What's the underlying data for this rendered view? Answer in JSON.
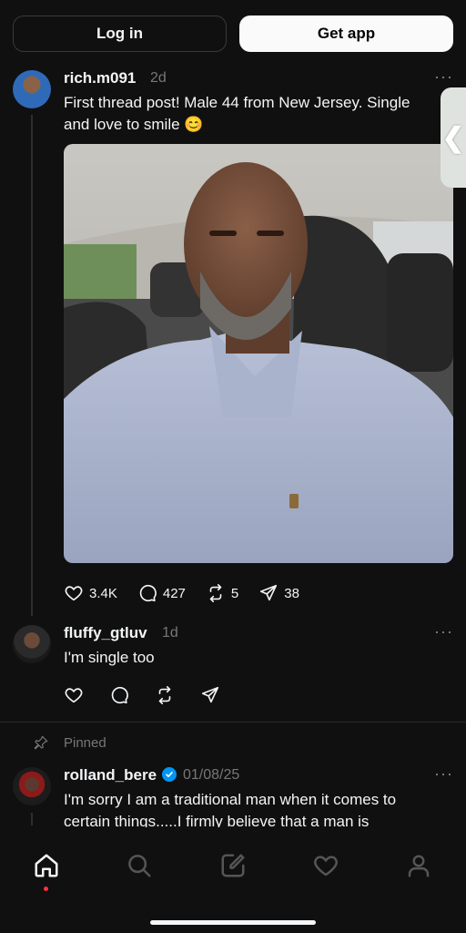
{
  "header": {
    "login_label": "Log in",
    "get_app_label": "Get app"
  },
  "posts": [
    {
      "username": "rich.m091",
      "time": "2d",
      "text_line1": "First thread post! Male 44 from New Jersey. Single",
      "text_line2": "and love to smile 😊",
      "likes": "3.4K",
      "replies": "427",
      "reposts": "5",
      "shares": "38"
    },
    {
      "username": "fluffy_gtluv",
      "time": "1d",
      "text": "I'm single too"
    },
    {
      "pinned_label": "Pinned",
      "username": "rolland_bere",
      "time": "01/08/25",
      "text_line1": "I'm sorry I am a traditional man when it comes to",
      "text_line2": "certain things.....I firmly believe that a man is"
    }
  ],
  "side_tab_glyph": "❮",
  "colors": {
    "background": "#101010",
    "verified": "#0095f6",
    "notification_dot": "#ff3040"
  },
  "nav": [
    "home-icon",
    "search-icon",
    "compose-icon",
    "heart-icon",
    "profile-icon"
  ]
}
